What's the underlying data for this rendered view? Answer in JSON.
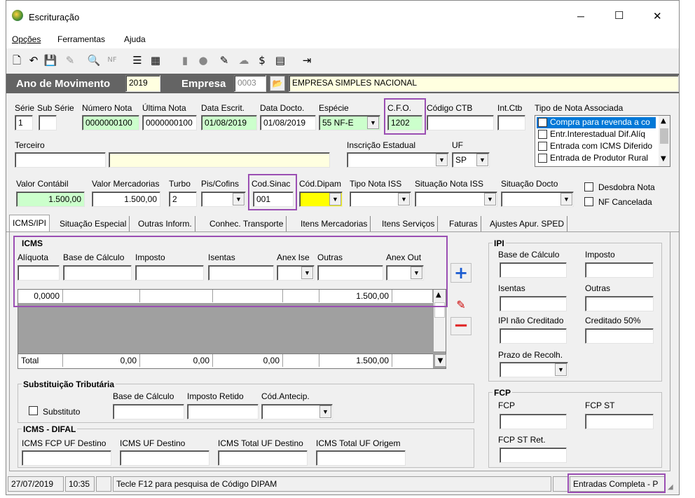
{
  "window": {
    "title": "Escrituração",
    "min": "─",
    "max": "☐",
    "close": "✕"
  },
  "menu": [
    "Opções",
    "Ferramentas",
    "Ajuda"
  ],
  "header": {
    "ano_label": "Ano de Movimento",
    "ano_value": "2019",
    "empresa_label": "Empresa",
    "empresa_code": "0003",
    "empresa_name": "EMPRESA SIMPLES NACIONAL"
  },
  "row1": {
    "serie_label": "Série",
    "serie_value": "1",
    "subserie_label": "Sub Série",
    "subserie_value": "",
    "numero_label": "Número Nota",
    "numero_value": "0000000100",
    "ultima_label": "Última Nota",
    "ultima_value": "0000000100",
    "data_escrit_label": "Data Escrit.",
    "data_escrit_value": "01/08/2019",
    "data_docto_label": "Data Docto.",
    "data_docto_value": "01/08/2019",
    "especie_label": "Espécie",
    "especie_value": "55  NF-E",
    "cfo_label": "C.F.O.",
    "cfo_value": "1202",
    "ctb_label": "Código CTB",
    "ctb_value": "",
    "intctb_label": "Int.Ctb",
    "intctb_value": "",
    "tipo_label": "Tipo de Nota Associada",
    "tipo_items": [
      "Compra para revenda a co",
      "Entr.Interestadual Dif.Alíq",
      "Entrada com ICMS Diferido",
      "Entrada de Produtor Rural"
    ]
  },
  "row2": {
    "terceiro_label": "Terceiro",
    "ie_label": "Inscrição Estadual",
    "uf_label": "UF",
    "uf_value": "SP"
  },
  "row3": {
    "valor_contabil_label": "Valor Contábil",
    "valor_contabil_value": "1.500,00",
    "valor_merc_label": "Valor Mercadorias",
    "valor_merc_value": "1.500,00",
    "turbo_label": "Turbo",
    "turbo_value": "2",
    "piscofins_label": "Pis/Cofins",
    "codsinac_label": "Cod.Sinac",
    "codsinac_value": "001",
    "coddipam_label": "Cód.Dipam",
    "tipoiss_label": "Tipo Nota ISS",
    "sitiss_label": "Situação Nota ISS",
    "sitdocto_label": "Situação Docto",
    "desdobra_label": "Desdobra Nota",
    "nfcancelada_label": "NF Cancelada"
  },
  "tabs": [
    "ICMS/IPI",
    "Situação Especial",
    "Outras Inform.",
    "Conhec. Transporte",
    "Itens Mercadorias",
    "Itens Serviços",
    "Faturas",
    "Ajustes Apur. SPED"
  ],
  "icms": {
    "title": "ICMS",
    "cols": [
      "Alíquota",
      "Base de Cálculo",
      "Imposto",
      "Isentas",
      "Anex Ise",
      "Outras",
      "Anex Out"
    ],
    "row": [
      "0,0000",
      "",
      "",
      "",
      "",
      "1.500,00",
      ""
    ],
    "total_label": "Total",
    "totals": [
      "0,00",
      "0,00",
      "0,00",
      "1.500,00"
    ]
  },
  "st": {
    "title": "Substituição Tributária",
    "substituto_label": "Substituto",
    "base_label": "Base de Cálculo",
    "retido_label": "Imposto Retido",
    "antecip_label": "Cód.Antecip."
  },
  "difal": {
    "title": "ICMS - DIFAL",
    "labels": [
      "ICMS FCP UF Destino",
      "ICMS UF Destino",
      "ICMS Total UF Destino",
      "ICMS Total UF Origem"
    ]
  },
  "ipi": {
    "title": "IPI",
    "base": "Base de Cálculo",
    "imposto": "Imposto",
    "isentas": "Isentas",
    "outras": "Outras",
    "naocred": "IPI não Creditado",
    "cred50": "Creditado 50%",
    "prazo": "Prazo de Recolh."
  },
  "fcp": {
    "title": "FCP",
    "fcp": "FCP",
    "fcpst": "FCP ST",
    "fcpstret": "FCP ST Ret."
  },
  "statusbar": {
    "date": "27/07/2019",
    "time": "10:35",
    "hint": "Tecle F12 para pesquisa de Código DIPAM",
    "mode": "Entradas Completa - P"
  },
  "colors": {
    "header_bg": "#646464",
    "highlight": "#9b4fb3",
    "green": "#ccffcc",
    "yellow": "#ffff00",
    "selected": "#0078d7"
  }
}
